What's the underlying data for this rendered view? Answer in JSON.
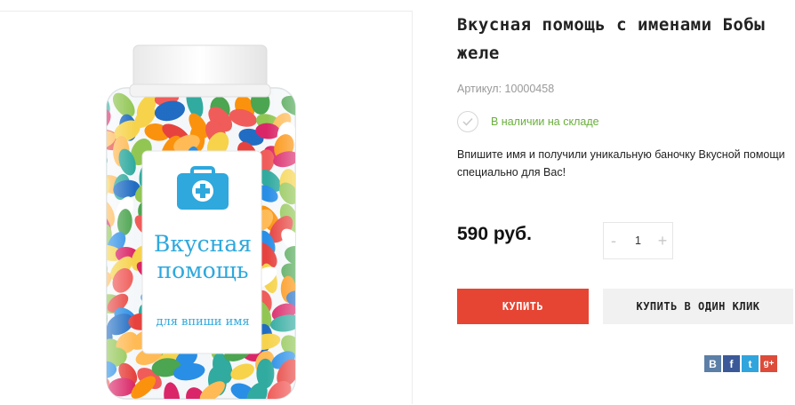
{
  "product": {
    "title": "Вкусная помощь с именами Бобы желе",
    "sku": "Артикул: 10000458",
    "stock_status": "В наличии на складе",
    "description": "Впишите имя и получили уникальную баночку Вкусной помощи специально для Вас!",
    "price": "590 руб."
  },
  "image": {
    "label_line1": "Вкусная",
    "label_line2": "помощь",
    "label_sub": "для впиши имя"
  },
  "quantity": {
    "minus": "-",
    "value": "1",
    "plus": "+"
  },
  "buttons": {
    "buy": "КУПИТЬ",
    "one_click": "КУПИТЬ В ОДИН КЛИК"
  },
  "share": {
    "vk": "B",
    "facebook": "f",
    "twitter": "t",
    "google": "g+"
  },
  "colors": {
    "accent": "#e74533",
    "stock": "#6aaf3c",
    "label_blue": "#2ea8dd",
    "vk": "#5b7fa6",
    "facebook": "#3b5998",
    "twitter": "#2fa4dd",
    "google": "#dd4b39"
  },
  "icons": [
    "medical-kit-icon",
    "checkmark-icon",
    "vk-icon",
    "facebook-icon",
    "twitter-icon",
    "google-plus-icon"
  ]
}
